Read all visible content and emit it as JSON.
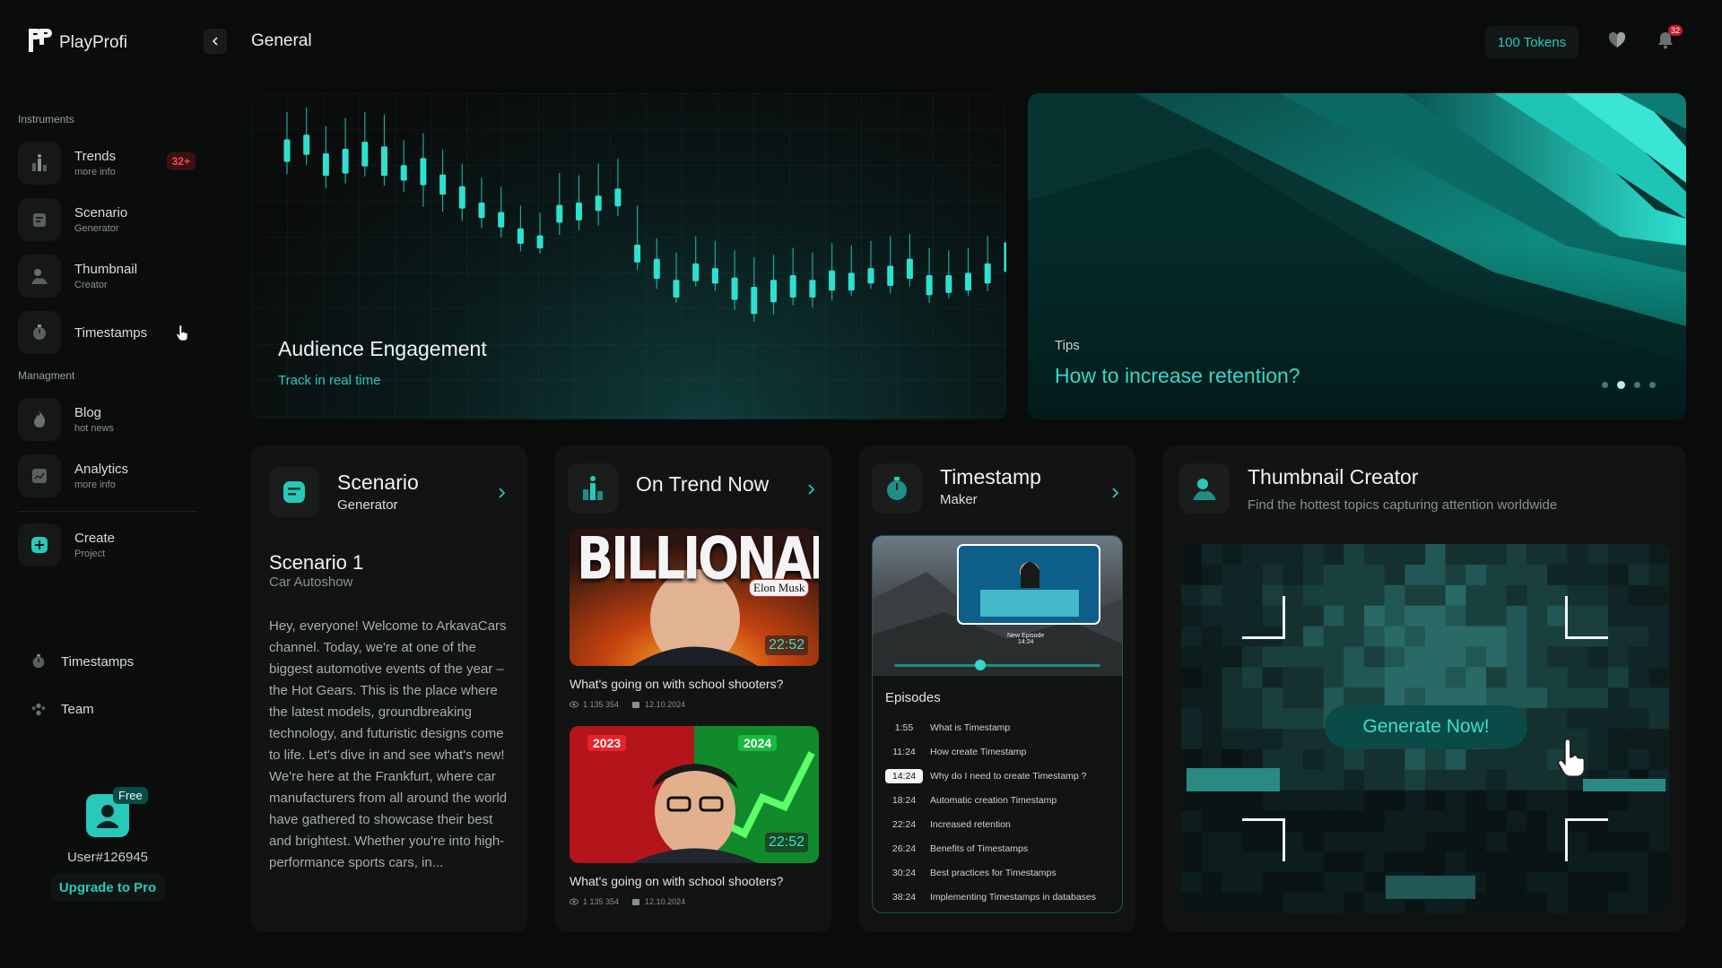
{
  "app": {
    "name": "PlayProfi"
  },
  "header": {
    "title": "General",
    "tokens": "100 Tokens",
    "notification_count": "32"
  },
  "sidebar": {
    "instruments_label": "Instruments",
    "management_label": "Managment",
    "items": [
      {
        "title": "Trends",
        "sub": "more info",
        "badge": "32+"
      },
      {
        "title": "Scenario",
        "sub": "Generator"
      },
      {
        "title": "Thumbnail",
        "sub": "Creator"
      },
      {
        "title": "Timestamps"
      },
      {
        "title": "Blog",
        "sub": "hot news"
      },
      {
        "title": "Analytics",
        "sub": "more info"
      },
      {
        "title": "Create",
        "sub": "Project"
      }
    ],
    "bottom": [
      {
        "title": "Timestamps"
      },
      {
        "title": "Team"
      }
    ],
    "user": {
      "plan": "Free",
      "id": "User#126945",
      "upgrade": "Upgrade to Pro"
    }
  },
  "hero": {
    "engagement": {
      "title": "Audience Engagement",
      "sub": "Track in real time"
    },
    "tips": {
      "label": "Tips",
      "title": "How to increase retention?",
      "slides": 4,
      "active_slide": 2
    }
  },
  "cards": {
    "scenario": {
      "title": "Scenario",
      "sub": "Generator",
      "name": "Scenario 1",
      "category": "Car Autoshow",
      "body": "Hey, everyone! Welcome to ArkavaCars channel. Today, we're at one of the biggest automotive events of the year – the Hot Gears. This is the place where the latest models, groundbreaking technology, and futuristic designs come to life. Let's dive in and see what's new! We're here at the Frankfurt, where car manufacturers from all around the world have gathered to showcase their best and brightest. Whether you're into high-performance sports cars, in..."
    },
    "trend": {
      "title": "On Trend Now",
      "videos": [
        {
          "thumb_text": "BILLIONAIRE",
          "thumb_tag": "Elon Musk",
          "duration": "22:52",
          "title": "What's going on with school shooters?",
          "views": "1 135 354",
          "date": "12.10.2024"
        },
        {
          "thumb_year_left": "2023",
          "thumb_year_right": "2024",
          "duration": "22:52",
          "title": "What's going on with school shooters?",
          "views": "1 135 354",
          "date": "12.10.2024"
        }
      ]
    },
    "timestamp": {
      "title": "Timestamp",
      "sub": "Maker",
      "preview_caption": "New Episode",
      "preview_time": "14:24",
      "episodes_label": "Episodes",
      "episodes": [
        {
          "time": "1:55",
          "label": "What is Timestamp"
        },
        {
          "time": "11:24",
          "label": "How create Timestamp"
        },
        {
          "time": "14:24",
          "label": "Why do I need to create Timestamp ?",
          "active": true
        },
        {
          "time": "18:24",
          "label": "Automatic creation Timestamp"
        },
        {
          "time": "22:24",
          "label": "Increased retention"
        },
        {
          "time": "26:24",
          "label": "Benefits of Timestamps"
        },
        {
          "time": "30:24",
          "label": "Best practices for Timestamps"
        },
        {
          "time": "38:24",
          "label": "Implementing Timestamps in databases"
        }
      ]
    },
    "thumbnail": {
      "title": "Thumbnail Creator",
      "sub": "Find the hottest topics capturing attention worldwide",
      "button": "Generate Now!"
    }
  },
  "colors": {
    "accent": "#28c9bb",
    "background": "#0a0b0b",
    "card": "#121313",
    "badge": "#ff4a55"
  },
  "chart_data": {
    "type": "candlestick",
    "title": "Audience Engagement",
    "candles": [
      [
        70,
        82,
        92,
        100
      ],
      [
        78,
        88,
        96,
        104
      ],
      [
        58,
        70,
        80,
        88
      ],
      [
        62,
        72,
        84,
        95
      ],
      [
        68,
        78,
        90,
        100
      ],
      [
        60,
        70,
        86,
        98
      ],
      [
        55,
        66,
        70,
        76
      ],
      [
        42,
        62,
        76,
        82
      ],
      [
        38,
        54,
        62,
        68
      ],
      [
        30,
        42,
        52,
        56
      ],
      [
        24,
        34,
        38,
        44
      ],
      [
        16,
        26,
        30,
        36
      ],
      [
        4,
        12,
        16,
        20
      ],
      [
        2,
        8,
        10,
        14
      ],
      [
        18,
        30,
        36,
        48
      ],
      [
        22,
        32,
        38,
        46
      ],
      [
        26,
        40,
        44,
        56
      ],
      [
        34,
        44,
        50,
        60
      ],
      [
        -12,
        -4,
        2,
        20
      ],
      [
        -28,
        -18,
        -10,
        -8
      ],
      [
        -40,
        -34,
        -28,
        -20
      ],
      [
        -26,
        -20,
        -14,
        -6
      ],
      [
        -30,
        -22,
        -18,
        -10
      ],
      [
        -46,
        -36,
        -26,
        -18
      ],
      [
        -56,
        -48,
        -34,
        -24
      ],
      [
        -50,
        -38,
        -28,
        -22
      ],
      [
        -42,
        -34,
        -24,
        -16
      ],
      [
        -44,
        -34,
        -28,
        -20
      ],
      [
        -38,
        -28,
        -20,
        -12
      ],
      [
        -34,
        -28,
        -22,
        -14
      ],
      [
        -28,
        -22,
        -18,
        -10
      ],
      [
        -32,
        -24,
        -16,
        -6
      ],
      [
        -26,
        -18,
        -10,
        -4
      ],
      [
        -40,
        -32,
        -24,
        -16
      ],
      [
        -36,
        -30,
        -24,
        -18
      ],
      [
        -34,
        -28,
        -22,
        -16
      ],
      [
        -30,
        -22,
        -14,
        -6
      ],
      [
        -24,
        -12,
        4,
        22
      ]
    ]
  }
}
